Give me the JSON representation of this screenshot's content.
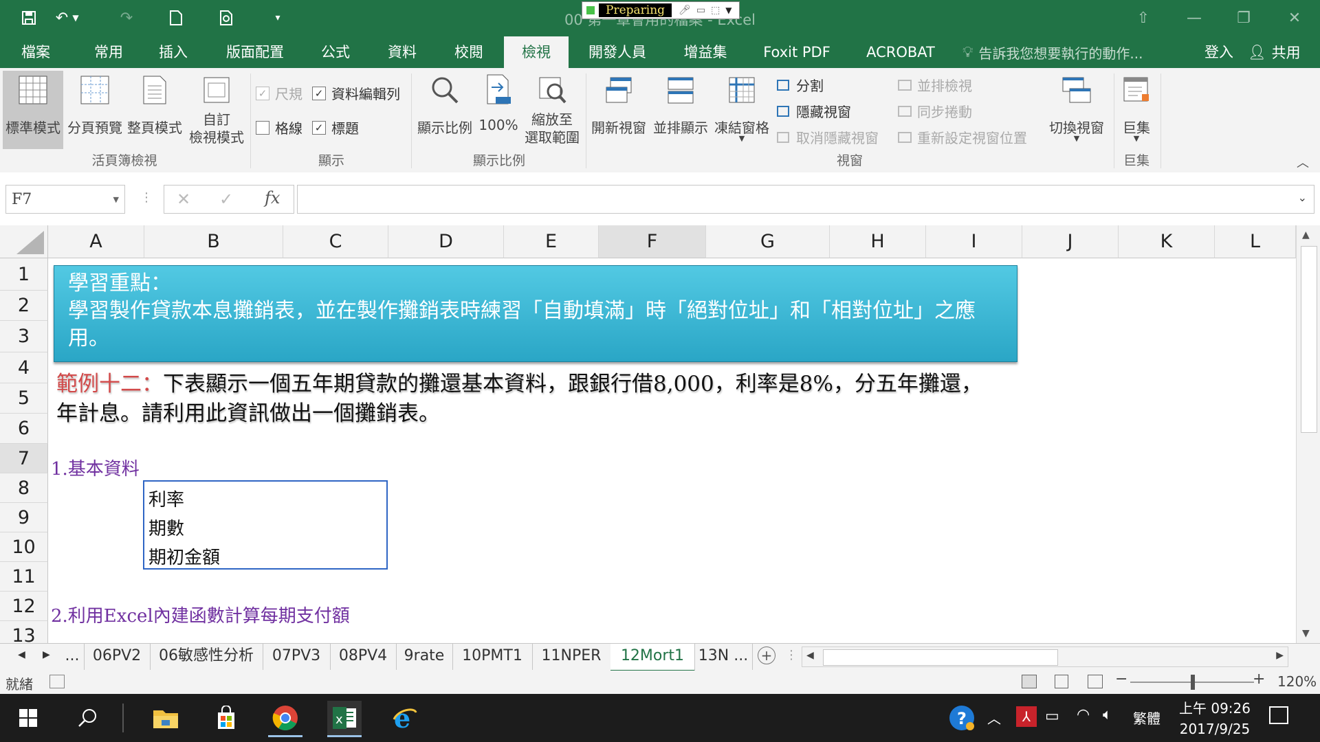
{
  "window": {
    "title": "00 第一章會用的檔案 - Excel",
    "recorder_status": "Preparing"
  },
  "tabs": [
    {
      "label": "檔案"
    },
    {
      "label": "常用"
    },
    {
      "label": "插入"
    },
    {
      "label": "版面配置"
    },
    {
      "label": "公式"
    },
    {
      "label": "資料"
    },
    {
      "label": "校閱"
    },
    {
      "label": "檢視"
    },
    {
      "label": "開發人員"
    },
    {
      "label": "增益集"
    },
    {
      "label": "Foxit PDF"
    },
    {
      "label": "ACROBAT"
    }
  ],
  "active_tab": "檢視",
  "tell_me": "告訴我您想要執行的動作...",
  "signin": "登入",
  "share": "共用",
  "ribbon": {
    "workbook_views": {
      "label": "活頁簿檢視",
      "normal": "標準模式",
      "page_break": "分頁預覽",
      "page_layout": "整頁模式",
      "custom_line1": "自訂",
      "custom_line2": "檢視模式"
    },
    "show": {
      "label": "顯示",
      "ruler": "尺規",
      "formula_bar": "資料編輯列",
      "gridlines": "格線",
      "headings": "標題"
    },
    "zoom": {
      "label": "顯示比例",
      "zoom": "顯示比例",
      "zoom100": "100%",
      "zoom_sel_line1": "縮放至",
      "zoom_sel_line2": "選取範圍"
    },
    "window": {
      "label": "視窗",
      "new_window": "開新視窗",
      "arrange_all": "並排顯示",
      "freeze_panes": "凍結窗格",
      "split": "分割",
      "hide": "隱藏視窗",
      "unhide": "取消隱藏視窗",
      "side_by_side": "並排檢視",
      "sync_scroll": "同步捲動",
      "reset_position": "重新設定視窗位置",
      "switch_windows": "切換視窗"
    },
    "macros": {
      "label": "巨集",
      "macros": "巨集"
    }
  },
  "formula_bar": {
    "name_box": "F7",
    "formula": ""
  },
  "columns": [
    "A",
    "B",
    "C",
    "D",
    "E",
    "F",
    "G",
    "H",
    "I",
    "J",
    "K",
    "L"
  ],
  "rows": [
    "1",
    "2",
    "3",
    "4",
    "5",
    "6",
    "7",
    "8",
    "9",
    "10",
    "11",
    "12",
    "13"
  ],
  "sheet": {
    "banner_line1": "學習重點：",
    "banner_line2": "學習製作貸款本息攤銷表，並在製作攤銷表時練習「自動填滿」時「絕對位址」和「相對位址」之應",
    "banner_line3": "用。",
    "example_label": "範例十二：",
    "example_text1": "下表顯示一個五年期貸款的攤還基本資料，跟銀行借8,000，利率是8%，分五年攤還，",
    "example_text2": "年計息。請利用此資訊做出一個攤銷表。",
    "section1": "1.基本資料",
    "info_rate": "利率",
    "info_periods": "期數",
    "info_principal": "期初金額",
    "section2": "2.利用Excel內建函數計算每期支付額"
  },
  "sheet_tabs": [
    "...",
    "06PV2",
    "06敏感性分析",
    "07PV3",
    "08PV4",
    "9rate",
    "10PMT1",
    "11NPER",
    "12Mort1",
    "13N ..."
  ],
  "active_sheet": "12Mort1",
  "status": {
    "ready": "就緒",
    "zoom": "120%"
  },
  "taskbar": {
    "ime": "繁體",
    "time": "上午 09:26",
    "date": "2017/9/25"
  },
  "colors": {
    "excel_green": "#217346",
    "banner": "#34b3d3",
    "accent_purple": "#7030a0",
    "example_red": "#d24a4a"
  }
}
